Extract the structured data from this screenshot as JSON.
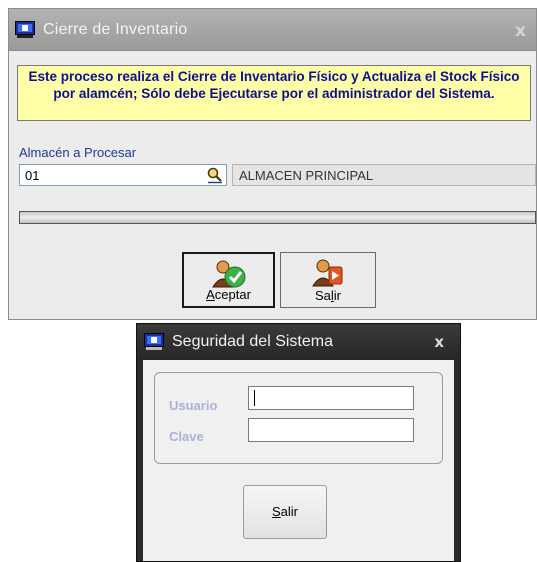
{
  "inventory_window": {
    "title": "Cierre de Inventario",
    "close_glyph": "x",
    "notice": "Este proceso realiza el Cierre de Inventario Físico y Actualiza el Stock Físico por alamcén; Sólo debe Ejecutarse por el administrador del Sistema.",
    "almacen_label": "Almacén a Procesar",
    "almacen_code": "01",
    "almacen_name": "ALMACEN PRINCIPAL",
    "progress_percent": 0,
    "buttons": {
      "aceptar": {
        "mnemonic": "A",
        "rest": "ceptar",
        "icon": "user-check-icon"
      },
      "salir": {
        "pre": "Sa",
        "mnemonic": "l",
        "post": "ir",
        "icon": "user-exit-icon"
      }
    },
    "accent_colors": {
      "notice_bg": "#ffffa8",
      "notice_text": "#10108c"
    }
  },
  "security_window": {
    "title": "Seguridad del Sistema",
    "close_glyph": "x",
    "usuario_label": "Usuario",
    "clave_label": "Clave",
    "usuario_value": "",
    "clave_value": "",
    "salir": {
      "mnemonic": "S",
      "rest": "alir"
    }
  }
}
